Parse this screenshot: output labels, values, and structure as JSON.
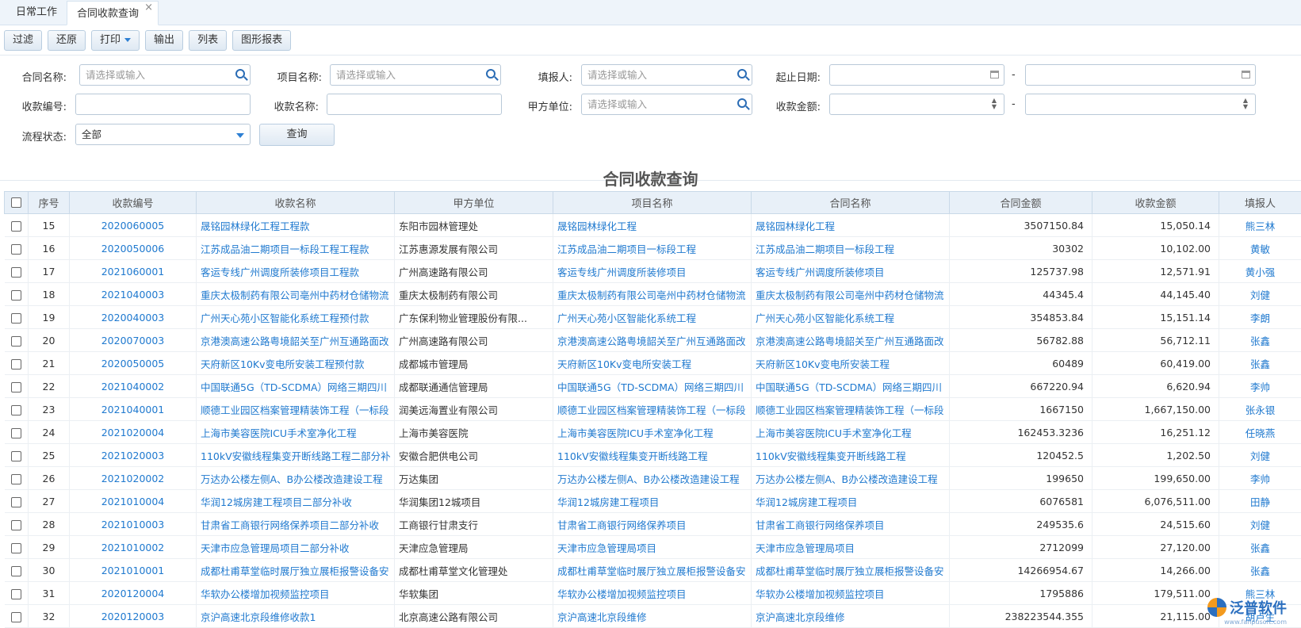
{
  "tabs": [
    {
      "label": "日常工作",
      "active": false
    },
    {
      "label": "合同收款查询",
      "active": true
    }
  ],
  "toolbar": {
    "filter": "过滤",
    "restore": "还原",
    "print": "打印",
    "export": "输出",
    "list": "列表",
    "chart_report": "图形报表"
  },
  "filters": {
    "contract_name": {
      "label": "合同名称:",
      "placeholder": "请选择或输入"
    },
    "project_name": {
      "label": "项目名称:",
      "placeholder": "请选择或输入"
    },
    "reporter": {
      "label": "填报人:",
      "placeholder": "请选择或输入"
    },
    "date_range": {
      "label": "起止日期:",
      "sep": "-"
    },
    "receipt_no": {
      "label": "收款编号:"
    },
    "receipt_name": {
      "label": "收款名称:"
    },
    "party_a": {
      "label": "甲方单位:",
      "placeholder": "请选择或输入"
    },
    "amount": {
      "label": "收款金额:",
      "sep": "-"
    },
    "status": {
      "label": "流程状态:",
      "value": "全部"
    },
    "query_button": "查询"
  },
  "report_title": "合同收款查询",
  "table": {
    "headers": [
      "序号",
      "收款编号",
      "收款名称",
      "甲方单位",
      "项目名称",
      "合同名称",
      "合同金额",
      "收款金额",
      "填报人"
    ],
    "rows": [
      {
        "seq": "15",
        "no": "2020060005",
        "name": "晟铭园林绿化工程工程款",
        "party": "东阳市园林管理处",
        "project": "晟铭园林绿化工程",
        "contract": "晟铭园林绿化工程",
        "contract_amt": "3507150.84",
        "receipt_amt": "15,050.14",
        "reporter": "熊三林"
      },
      {
        "seq": "16",
        "no": "2020050006",
        "name": "江苏成品油二期项目一标段工程工程款",
        "party": "江苏惠源发展有限公司",
        "project": "江苏成品油二期项目一标段工程",
        "contract": "江苏成品油二期项目一标段工程",
        "contract_amt": "30302",
        "receipt_amt": "10,102.00",
        "reporter": "黄敏"
      },
      {
        "seq": "17",
        "no": "2021060001",
        "name": "客运专线广州调度所装修项目工程款",
        "party": "广州高速路有限公司",
        "project": "客运专线广州调度所装修项目",
        "contract": "客运专线广州调度所装修项目",
        "contract_amt": "125737.98",
        "receipt_amt": "12,571.91",
        "reporter": "黄小强"
      },
      {
        "seq": "18",
        "no": "2021040003",
        "name": "重庆太极制药有限公司亳州中药材仓储物流",
        "party": "重庆太极制药有限公司",
        "project": "重庆太极制药有限公司亳州中药材仓储物流",
        "contract": "重庆太极制药有限公司亳州中药材仓储物流",
        "contract_amt": "44345.4",
        "receipt_amt": "44,145.40",
        "reporter": "刘健"
      },
      {
        "seq": "19",
        "no": "2020040003",
        "name": "广州天心苑小区智能化系统工程预付款",
        "party": "广东保利物业管理股份有限...",
        "project": "广州天心苑小区智能化系统工程",
        "contract": "广州天心苑小区智能化系统工程",
        "contract_amt": "354853.84",
        "receipt_amt": "15,151.14",
        "reporter": "李朗"
      },
      {
        "seq": "20",
        "no": "2020070003",
        "name": "京港澳高速公路粤境韶关至广州互通路面改",
        "party": "广州高速路有限公司",
        "project": "京港澳高速公路粤境韶关至广州互通路面改",
        "contract": "京港澳高速公路粤境韶关至广州互通路面改",
        "contract_amt": "56782.88",
        "receipt_amt": "56,712.11",
        "reporter": "张鑫"
      },
      {
        "seq": "21",
        "no": "2020050005",
        "name": "天府新区10Kv变电所安装工程预付款",
        "party": "成都城市管理局",
        "project": "天府新区10Kv变电所安装工程",
        "contract": "天府新区10Kv变电所安装工程",
        "contract_amt": "60489",
        "receipt_amt": "60,419.00",
        "reporter": "张鑫"
      },
      {
        "seq": "22",
        "no": "2021040002",
        "name": "中国联通5G（TD-SCDMA）网络三期四川",
        "party": "成都联通通信管理局",
        "project": "中国联通5G（TD-SCDMA）网络三期四川",
        "contract": "中国联通5G（TD-SCDMA）网络三期四川",
        "contract_amt": "667220.94",
        "receipt_amt": "6,620.94",
        "reporter": "李帅"
      },
      {
        "seq": "23",
        "no": "2021040001",
        "name": "顺德工业园区档案管理精装饰工程（一标段",
        "party": "润美远海置业有限公司",
        "project": "顺德工业园区档案管理精装饰工程（一标段",
        "contract": "顺德工业园区档案管理精装饰工程（一标段",
        "contract_amt": "1667150",
        "receipt_amt": "1,667,150.00",
        "reporter": "张永银"
      },
      {
        "seq": "24",
        "no": "2021020004",
        "name": "上海市美容医院ICU手术室净化工程",
        "party": "上海市美容医院",
        "project": "上海市美容医院ICU手术室净化工程",
        "contract": "上海市美容医院ICU手术室净化工程",
        "contract_amt": "162453.3236",
        "receipt_amt": "16,251.12",
        "reporter": "任晓燕"
      },
      {
        "seq": "25",
        "no": "2021020003",
        "name": "110kV安徽线程集变开断线路工程二部分补",
        "party": "安徽合肥供电公司",
        "project": "110kV安徽线程集变开断线路工程",
        "contract": "110kV安徽线程集变开断线路工程",
        "contract_amt": "120452.5",
        "receipt_amt": "1,202.50",
        "reporter": "刘健"
      },
      {
        "seq": "26",
        "no": "2021020002",
        "name": "万达办公楼左侧A、B办公楼改造建设工程",
        "party": "万达集团",
        "project": "万达办公楼左侧A、B办公楼改造建设工程",
        "contract": "万达办公楼左侧A、B办公楼改造建设工程",
        "contract_amt": "199650",
        "receipt_amt": "199,650.00",
        "reporter": "李帅"
      },
      {
        "seq": "27",
        "no": "2021010004",
        "name": "华润12城房建工程项目二部分补收",
        "party": "华润集团12城项目",
        "project": "华润12城房建工程项目",
        "contract": "华润12城房建工程项目",
        "contract_amt": "6076581",
        "receipt_amt": "6,076,511.00",
        "reporter": "田静"
      },
      {
        "seq": "28",
        "no": "2021010003",
        "name": "甘肃省工商银行网络保养项目二部分补收",
        "party": "工商银行甘肃支行",
        "project": "甘肃省工商银行网络保养项目",
        "contract": "甘肃省工商银行网络保养项目",
        "contract_amt": "249535.6",
        "receipt_amt": "24,515.60",
        "reporter": "刘健"
      },
      {
        "seq": "29",
        "no": "2021010002",
        "name": "天津市应急管理局项目二部分补收",
        "party": "天津应急管理局",
        "project": "天津市应急管理局项目",
        "contract": "天津市应急管理局项目",
        "contract_amt": "2712099",
        "receipt_amt": "27,120.00",
        "reporter": "张鑫"
      },
      {
        "seq": "30",
        "no": "2021010001",
        "name": "成都杜甫草堂临时展厅独立展柜报警设备安",
        "party": "成都杜甫草堂文化管理处",
        "project": "成都杜甫草堂临时展厅独立展柜报警设备安",
        "contract": "成都杜甫草堂临时展厅独立展柜报警设备安",
        "contract_amt": "14266954.67",
        "receipt_amt": "14,266.00",
        "reporter": "张鑫"
      },
      {
        "seq": "31",
        "no": "2020120004",
        "name": "华软办公楼增加视频监控项目",
        "party": "华软集团",
        "project": "华软办公楼增加视频监控项目",
        "contract": "华软办公楼增加视频监控项目",
        "contract_amt": "1795886",
        "receipt_amt": "179,511.00",
        "reporter": "熊三林"
      },
      {
        "seq": "32",
        "no": "2020120003",
        "name": "京沪高速北京段维修收款1",
        "party": "北京高速公路有限公司",
        "project": "京沪高速北京段维修",
        "contract": "京沪高速北京段维修",
        "contract_amt": "238223544.355",
        "receipt_amt": "21,115.00",
        "reporter": "胡卢生"
      }
    ]
  },
  "logo": {
    "text": "泛普软件",
    "url": "www.fanpusoft.com"
  }
}
